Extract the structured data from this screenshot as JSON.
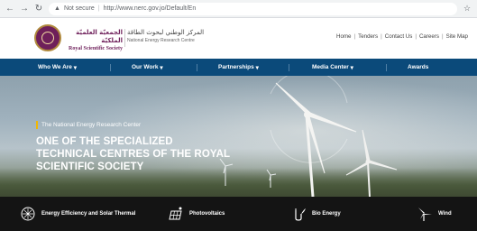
{
  "browser": {
    "back_icon": "back-arrow-icon",
    "forward_icon": "forward-arrow-icon",
    "reload_icon": "reload-icon",
    "security_label": "Not secure",
    "url": "http://www.nerc.gov.jo/Default/En"
  },
  "header": {
    "rss_arabic": "الجمعيّة العلميّة الملكيّة",
    "rss_english": "Royal Scientific Society",
    "nerc_arabic": "المركز الوطني لبحوث الطاقة",
    "nerc_english": "National Energy Research Centre",
    "links": [
      "Home",
      "Tenders",
      "Contact Us",
      "Careers",
      "Site Map"
    ],
    "pipe": "|"
  },
  "nav": {
    "items": [
      {
        "label": "Who We Are",
        "caret": "▾"
      },
      {
        "label": "Our Work",
        "caret": "▾"
      },
      {
        "label": "Partnerships",
        "caret": "▾"
      },
      {
        "label": "Media Center",
        "caret": "▾"
      },
      {
        "label": "Awards",
        "caret": ""
      }
    ]
  },
  "hero": {
    "subtitle": "The National Energy Research Center",
    "title": "ONE OF THE SPECIALIZED TECHNICAL CENTRES OF THE ROYAL SCIENTIFIC SOCIETY"
  },
  "sectors": [
    {
      "label": "Energy Efficiency and Solar Thermal",
      "icon": "energy-efficiency-icon"
    },
    {
      "label": "Photovoltaics",
      "icon": "photovoltaics-icon"
    },
    {
      "label": "Bio Energy",
      "icon": "bio-energy-icon"
    },
    {
      "label": "Wind",
      "icon": "wind-icon"
    }
  ],
  "colors": {
    "brand_purple": "#6e1f5a",
    "nav_blue": "#0b4a7a",
    "accent_yellow": "#f2b705"
  }
}
